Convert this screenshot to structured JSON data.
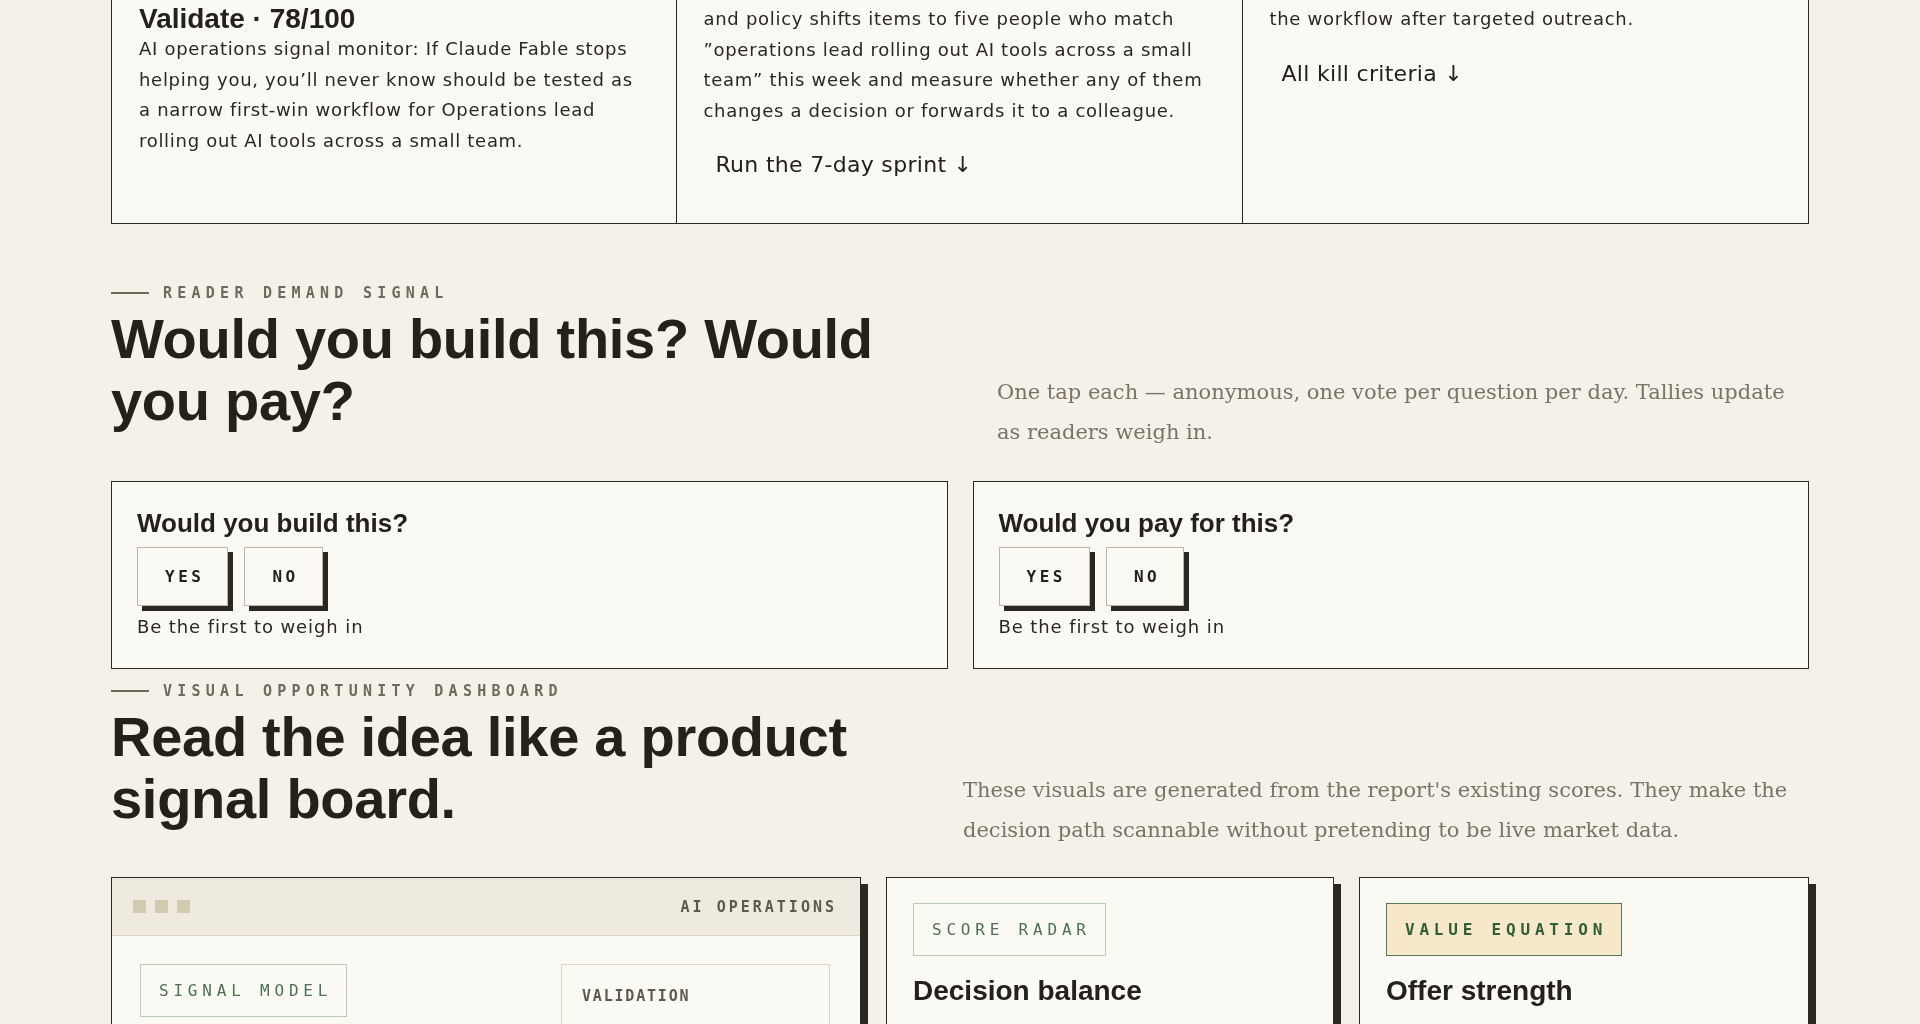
{
  "summary_cards": [
    {
      "title": "Validate · 78/100",
      "body": "AI operations signal monitor: If Claude Fable stops helping you, you’ll never know should be tested as a narrow first-win workflow for Operations lead rolling out AI tools across a small team."
    },
    {
      "body": "and policy shifts items to five people who match ”operations lead rolling out AI tools across a small team” this week and measure whether any of them changes a decision or forwards it to a colleague.",
      "link": "Run the 7-day sprint ↓"
    },
    {
      "body": "the workflow after targeted outreach.",
      "link": "All kill criteria ↓"
    }
  ],
  "demand_section": {
    "eyebrow": "READER DEMAND SIGNAL",
    "heading": "Would you build this? Would you pay?",
    "description": "One tap each — anonymous, one vote per question per day. Tallies update as readers weigh in.",
    "polls": [
      {
        "question": "Would you build this?",
        "buttons": [
          "YES",
          "NO"
        ],
        "tally": "Be the first to weigh in"
      },
      {
        "question": "Would you pay for this?",
        "buttons": [
          "YES",
          "NO"
        ],
        "tally": "Be the first to weigh in"
      }
    ]
  },
  "dashboard_section": {
    "eyebrow": "VISUAL OPPORTUNITY DASHBOARD",
    "heading": "Read the idea like a product signal board.",
    "description": "These visuals are generated from the report's existing scores. They make the decision path scannable without pretending to be live market data.",
    "main_card": {
      "header_label": "AI OPERATIONS",
      "tag": {
        "text": "SIGNAL MODEL",
        "highlighted": false
      },
      "validation_label": "VALIDATION"
    },
    "cards": [
      {
        "tag": {
          "text": "SCORE RADAR",
          "highlighted": false
        },
        "title": "Decision balance"
      },
      {
        "tag": {
          "text": "VALUE EQUATION",
          "highlighted": true
        },
        "title": "Offer strength"
      }
    ]
  }
}
